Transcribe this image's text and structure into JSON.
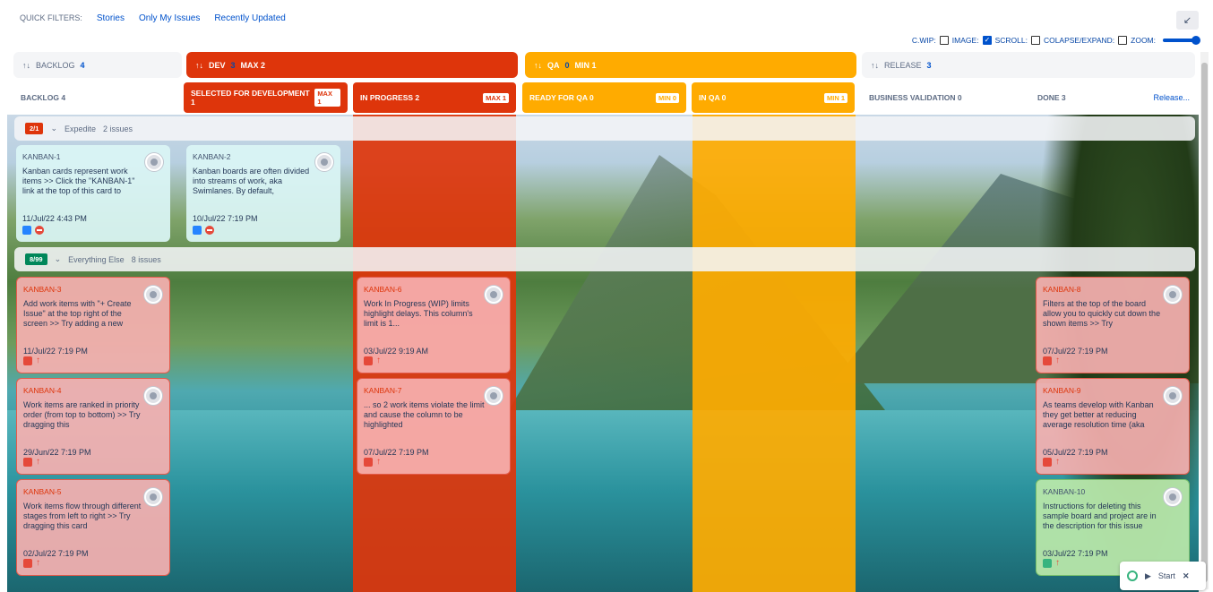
{
  "filters": {
    "label": "QUICK FILTERS:",
    "items": [
      "Stories",
      "Only My Issues",
      "Recently Updated"
    ]
  },
  "options": {
    "cwip": "C.WIP:",
    "image": "IMAGE:",
    "scroll": "SCROLL:",
    "collapse": "COLAPSE/EXPAND:",
    "zoom": "ZOOM:"
  },
  "groups": {
    "backlog": {
      "sort": "↑↓",
      "label": "BACKLOG",
      "count": "4"
    },
    "dev": {
      "sort": "↑↓",
      "label": "DEV",
      "count": "3",
      "max": "MAX 2"
    },
    "qa": {
      "sort": "↑↓",
      "label": "QA",
      "count": "0",
      "min": "MIN 1"
    },
    "release": {
      "sort": "↑↓",
      "label": "RELEASE",
      "count": "3"
    }
  },
  "columns": {
    "backlog": "BACKLOG 4",
    "selected": "SELECTED FOR DEVELOPMENT 1",
    "selected_badge": "MAX 1",
    "inprogress": "IN PROGRESS 2",
    "inprogress_badge": "MAX 1",
    "readyqa": "READY FOR QA 0",
    "readyqa_badge": "MIN 0",
    "inqa": "IN QA 0",
    "inqa_badge": "MIN 1",
    "bizval": "BUSINESS VALIDATION 0",
    "done": "DONE 3",
    "release_link": "Release..."
  },
  "swimlanes": [
    {
      "wip": "2/1",
      "name": "Expedite",
      "count": "2 issues"
    },
    {
      "wip": "8/99",
      "name": "Everything Else",
      "count": "8 issues"
    }
  ],
  "cards": {
    "k1": {
      "key": "KANBAN-1",
      "summary": "Kanban cards represent work items >> Click the \"KANBAN-1\" link at the top of this card to",
      "date": "11/Jul/22 4:43 PM"
    },
    "k2": {
      "key": "KANBAN-2",
      "summary": "Kanban boards are often divided into streams of work, aka Swimlanes. By default,",
      "date": "10/Jul/22 7:19 PM"
    },
    "k3": {
      "key": "KANBAN-3",
      "summary": "Add work items with \"+ Create Issue\" at the top right of the screen >> Try adding a new",
      "date": "11/Jul/22 7:19 PM"
    },
    "k4": {
      "key": "KANBAN-4",
      "summary": "Work items are ranked in priority order (from top to bottom) >> Try dragging this",
      "date": "29/Jun/22 7:19 PM"
    },
    "k5": {
      "key": "KANBAN-5",
      "summary": "Work items flow through different stages from left to right >> Try dragging this card",
      "date": "02/Jul/22 7:19 PM"
    },
    "k6": {
      "key": "KANBAN-6",
      "summary": "Work In Progress (WIP) limits highlight delays. This column's limit is 1...",
      "date": "03/Jul/22 9:19 AM"
    },
    "k7": {
      "key": "KANBAN-7",
      "summary": "... so 2 work items violate the limit and cause the column to be highlighted",
      "date": "07/Jul/22 7:19 PM"
    },
    "k8": {
      "key": "KANBAN-8",
      "summary": "Filters at the top of the board allow you to quickly cut down the shown items >> Try",
      "date": "07/Jul/22 7:19 PM"
    },
    "k9": {
      "key": "KANBAN-9",
      "summary": "As teams develop with Kanban they get better at reducing average resolution time (aka",
      "date": "05/Jul/22 7:19 PM"
    },
    "k10": {
      "key": "KANBAN-10",
      "summary": "Instructions for deleting this sample board and project are in the description for this issue",
      "date": "03/Jul/22 7:19 PM"
    }
  },
  "start_widget": {
    "label": "Start"
  },
  "colors": {
    "wip_red": "#de350b",
    "wip_yellow": "#ffab00",
    "accent": "#0052cc"
  }
}
